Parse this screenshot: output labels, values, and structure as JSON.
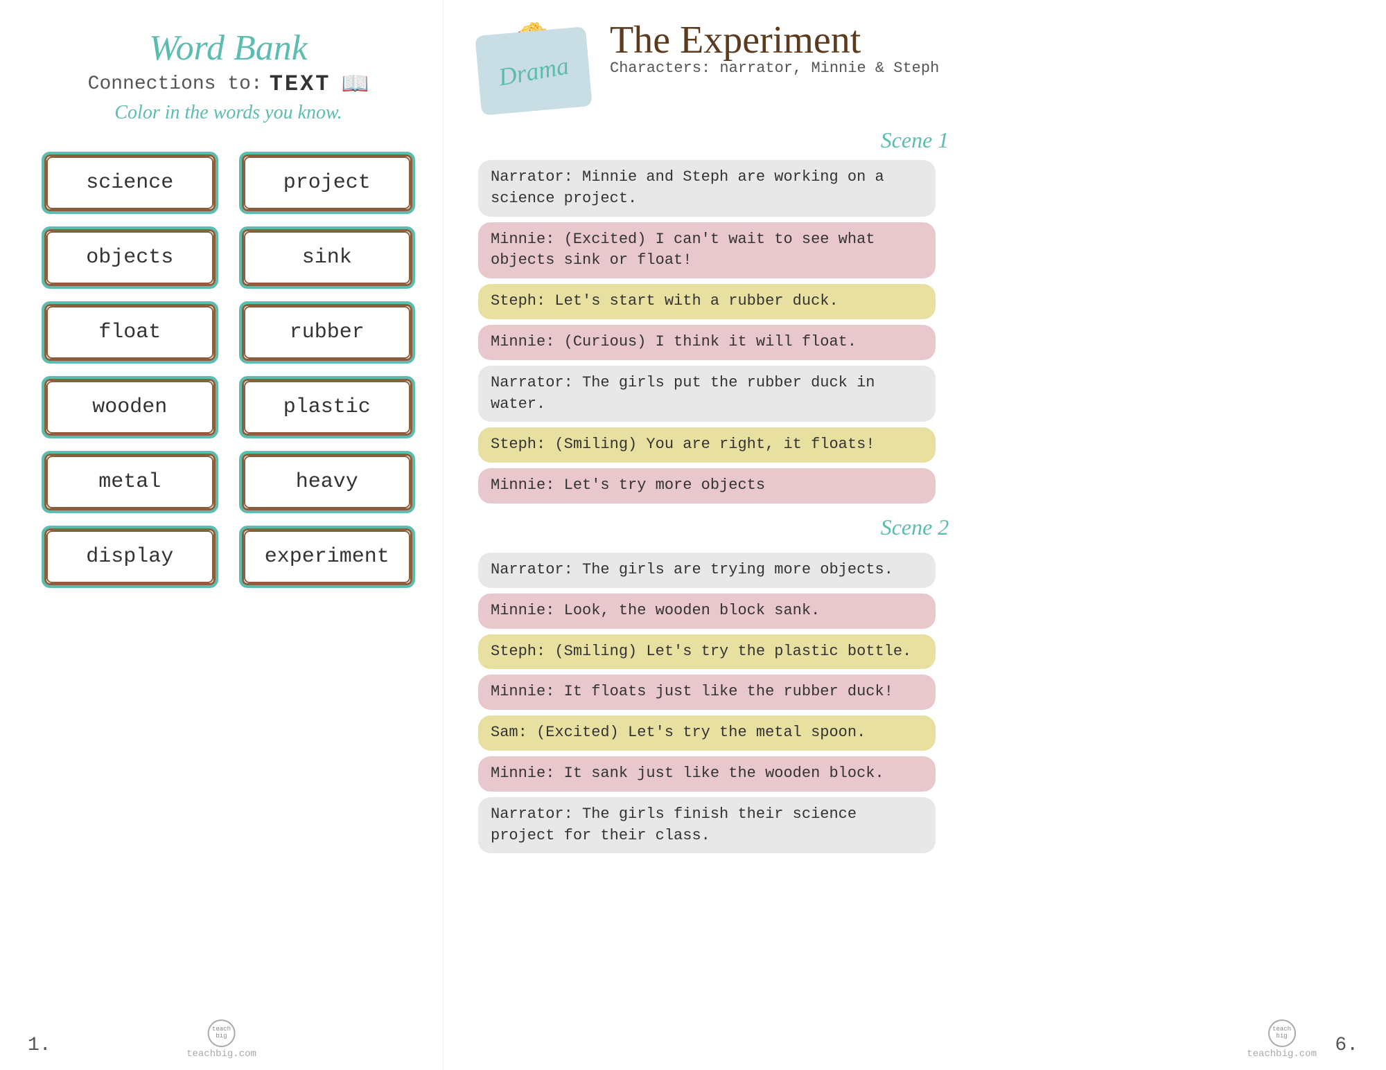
{
  "left": {
    "title": "Word Bank",
    "connections_label": "Connections to:",
    "connections_value": "TEXT",
    "instruction": "Color in the words you know.",
    "words": [
      {
        "word": "science"
      },
      {
        "word": "project"
      },
      {
        "word": "objects"
      },
      {
        "word": "sink"
      },
      {
        "word": "float"
      },
      {
        "word": "rubber"
      },
      {
        "word": "wooden"
      },
      {
        "word": "plastic"
      },
      {
        "word": "metal"
      },
      {
        "word": "heavy"
      },
      {
        "word": "display"
      },
      {
        "word": "experiment"
      }
    ],
    "page_number": "1.",
    "logo_text": "teach big",
    "logo_url": "teachbig.com"
  },
  "right": {
    "drama_label": "Drama",
    "title": "The Experiment",
    "characters": "Characters: narrator, Minnie & Steph",
    "scene1_label": "Scene 1",
    "scene2_label": "Scene 2",
    "dialogues": [
      {
        "speaker": "narrator",
        "text": "Narrator: Minnie and Steph are working on a science project.",
        "type": "narrator"
      },
      {
        "speaker": "minnie",
        "text": "Minnie: (Excited) I can't wait to see what objects sink or float!",
        "type": "minnie"
      },
      {
        "speaker": "steph",
        "text": "Steph: Let's start with a rubber duck.",
        "type": "steph"
      },
      {
        "speaker": "minnie",
        "text": "Minnie: (Curious) I think it will float.",
        "type": "minnie"
      },
      {
        "speaker": "narrator",
        "text": "Narrator: The girls put the rubber duck in water.",
        "type": "narrator"
      },
      {
        "speaker": "steph",
        "text": "Steph: (Smiling) You are right, it floats!",
        "type": "steph"
      },
      {
        "speaker": "minnie",
        "text": "Minnie: Let's try more objects",
        "type": "minnie"
      },
      {
        "speaker": "narrator2",
        "text": "Narrator: The girls are trying more objects.",
        "type": "narrator"
      },
      {
        "speaker": "minnie2",
        "text": "Minnie: Look, the wooden block sank.",
        "type": "minnie"
      },
      {
        "speaker": "steph2",
        "text": "Steph: (Smiling) Let's try the plastic bottle.",
        "type": "steph"
      },
      {
        "speaker": "minnie3",
        "text": "Minnie: It floats just like the rubber duck!",
        "type": "minnie"
      },
      {
        "speaker": "sam",
        "text": "Sam: (Excited) Let's try the metal spoon.",
        "type": "steph"
      },
      {
        "speaker": "minnie4",
        "text": "Minnie: It sank just like the wooden block.",
        "type": "minnie"
      },
      {
        "speaker": "narrator3",
        "text": "Narrator: The girls finish their science project for their class.",
        "type": "narrator"
      }
    ],
    "page_number": "6.",
    "logo_text": "teach big",
    "logo_url": "teachbig.com"
  }
}
